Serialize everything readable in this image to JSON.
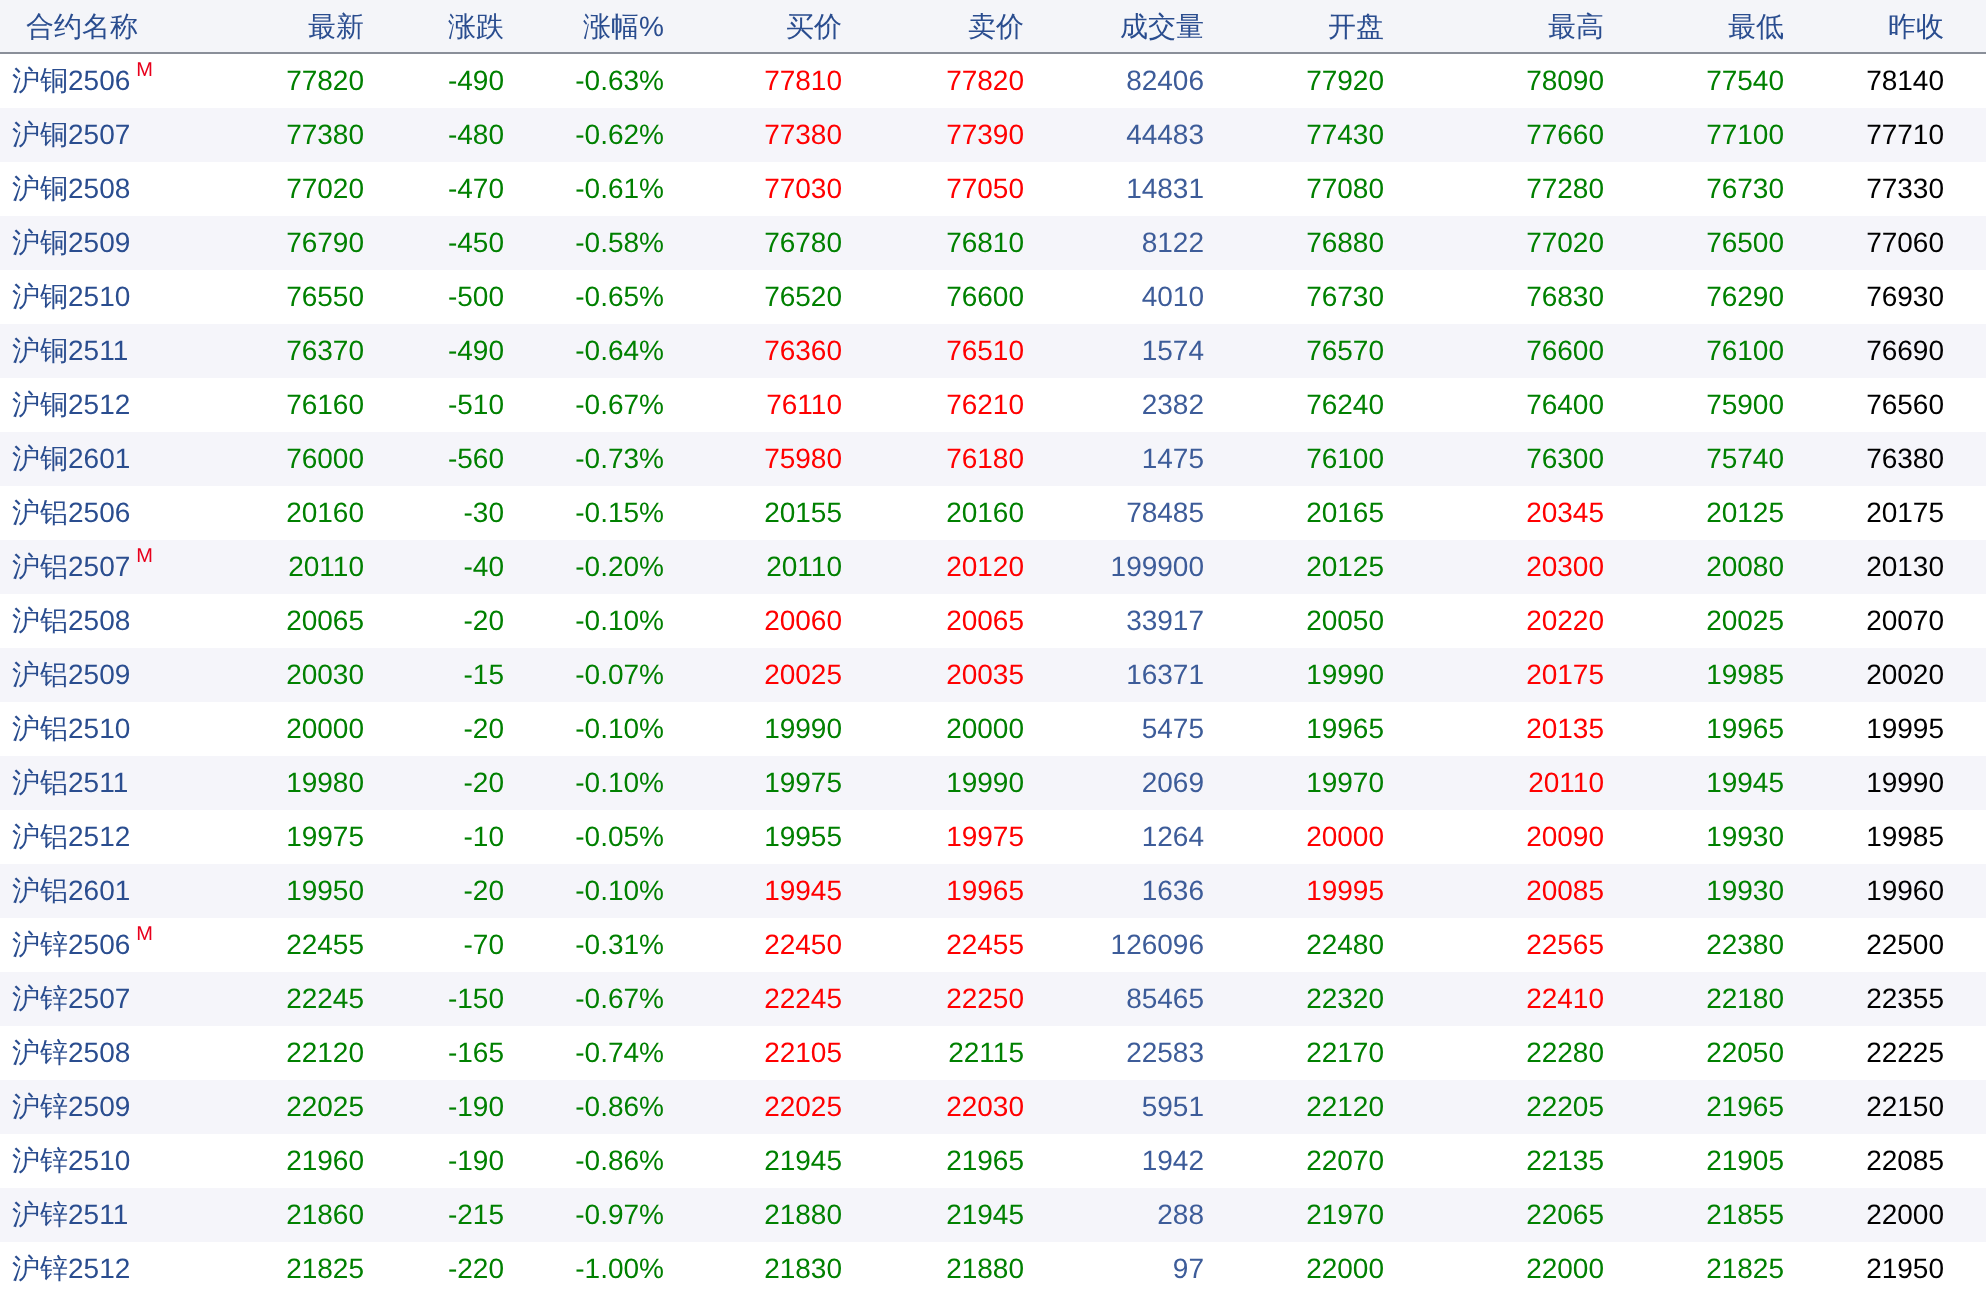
{
  "columns": [
    {
      "label": "合约名称",
      "kind": "name"
    },
    {
      "label": "最新",
      "kind": "value"
    },
    {
      "label": "涨跌",
      "kind": "value"
    },
    {
      "label": "涨幅%",
      "kind": "value"
    },
    {
      "label": "买价",
      "kind": "value"
    },
    {
      "label": "卖价",
      "kind": "value"
    },
    {
      "label": "成交量",
      "kind": "value"
    },
    {
      "label": "开盘",
      "kind": "value"
    },
    {
      "label": "最高",
      "kind": "value"
    },
    {
      "label": "最低",
      "kind": "value"
    },
    {
      "label": "昨收",
      "kind": "value"
    }
  ],
  "rows": [
    {
      "name": "沪铜2506",
      "badge": "M",
      "cells": [
        {
          "text": "77820",
          "color": "#008000"
        },
        {
          "text": "-490",
          "color": "#008000"
        },
        {
          "text": "-0.63%",
          "color": "#008000"
        },
        {
          "text": "77810",
          "color": "#ff0000"
        },
        {
          "text": "77820",
          "color": "#ff0000"
        },
        {
          "text": "82406",
          "color": "#3d5c99"
        },
        {
          "text": "77920",
          "color": "#008000"
        },
        {
          "text": "78090",
          "color": "#008000"
        },
        {
          "text": "77540",
          "color": "#008000"
        },
        {
          "text": "78140",
          "color": "#000000"
        }
      ]
    },
    {
      "name": "沪铜2507",
      "cells": [
        {
          "text": "77380",
          "color": "#008000"
        },
        {
          "text": "-480",
          "color": "#008000"
        },
        {
          "text": "-0.62%",
          "color": "#008000"
        },
        {
          "text": "77380",
          "color": "#ff0000"
        },
        {
          "text": "77390",
          "color": "#ff0000"
        },
        {
          "text": "44483",
          "color": "#3d5c99"
        },
        {
          "text": "77430",
          "color": "#008000"
        },
        {
          "text": "77660",
          "color": "#008000"
        },
        {
          "text": "77100",
          "color": "#008000"
        },
        {
          "text": "77710",
          "color": "#000000"
        }
      ]
    },
    {
      "name": "沪铜2508",
      "cells": [
        {
          "text": "77020",
          "color": "#008000"
        },
        {
          "text": "-470",
          "color": "#008000"
        },
        {
          "text": "-0.61%",
          "color": "#008000"
        },
        {
          "text": "77030",
          "color": "#ff0000"
        },
        {
          "text": "77050",
          "color": "#ff0000"
        },
        {
          "text": "14831",
          "color": "#3d5c99"
        },
        {
          "text": "77080",
          "color": "#008000"
        },
        {
          "text": "77280",
          "color": "#008000"
        },
        {
          "text": "76730",
          "color": "#008000"
        },
        {
          "text": "77330",
          "color": "#000000"
        }
      ]
    },
    {
      "name": "沪铜2509",
      "cells": [
        {
          "text": "76790",
          "color": "#008000"
        },
        {
          "text": "-450",
          "color": "#008000"
        },
        {
          "text": "-0.58%",
          "color": "#008000"
        },
        {
          "text": "76780",
          "color": "#008000"
        },
        {
          "text": "76810",
          "color": "#008000"
        },
        {
          "text": "8122",
          "color": "#3d5c99"
        },
        {
          "text": "76880",
          "color": "#008000"
        },
        {
          "text": "77020",
          "color": "#008000"
        },
        {
          "text": "76500",
          "color": "#008000"
        },
        {
          "text": "77060",
          "color": "#000000"
        }
      ]
    },
    {
      "name": "沪铜2510",
      "cells": [
        {
          "text": "76550",
          "color": "#008000"
        },
        {
          "text": "-500",
          "color": "#008000"
        },
        {
          "text": "-0.65%",
          "color": "#008000"
        },
        {
          "text": "76520",
          "color": "#008000"
        },
        {
          "text": "76600",
          "color": "#008000"
        },
        {
          "text": "4010",
          "color": "#3d5c99"
        },
        {
          "text": "76730",
          "color": "#008000"
        },
        {
          "text": "76830",
          "color": "#008000"
        },
        {
          "text": "76290",
          "color": "#008000"
        },
        {
          "text": "76930",
          "color": "#000000"
        }
      ]
    },
    {
      "name": "沪铜2511",
      "cells": [
        {
          "text": "76370",
          "color": "#008000"
        },
        {
          "text": "-490",
          "color": "#008000"
        },
        {
          "text": "-0.64%",
          "color": "#008000"
        },
        {
          "text": "76360",
          "color": "#ff0000"
        },
        {
          "text": "76510",
          "color": "#ff0000"
        },
        {
          "text": "1574",
          "color": "#3d5c99"
        },
        {
          "text": "76570",
          "color": "#008000"
        },
        {
          "text": "76600",
          "color": "#008000"
        },
        {
          "text": "76100",
          "color": "#008000"
        },
        {
          "text": "76690",
          "color": "#000000"
        }
      ]
    },
    {
      "name": "沪铜2512",
      "cells": [
        {
          "text": "76160",
          "color": "#008000"
        },
        {
          "text": "-510",
          "color": "#008000"
        },
        {
          "text": "-0.67%",
          "color": "#008000"
        },
        {
          "text": "76110",
          "color": "#ff0000"
        },
        {
          "text": "76210",
          "color": "#ff0000"
        },
        {
          "text": "2382",
          "color": "#3d5c99"
        },
        {
          "text": "76240",
          "color": "#008000"
        },
        {
          "text": "76400",
          "color": "#008000"
        },
        {
          "text": "75900",
          "color": "#008000"
        },
        {
          "text": "76560",
          "color": "#000000"
        }
      ]
    },
    {
      "name": "沪铜2601",
      "cells": [
        {
          "text": "76000",
          "color": "#008000"
        },
        {
          "text": "-560",
          "color": "#008000"
        },
        {
          "text": "-0.73%",
          "color": "#008000"
        },
        {
          "text": "75980",
          "color": "#ff0000"
        },
        {
          "text": "76180",
          "color": "#ff0000"
        },
        {
          "text": "1475",
          "color": "#3d5c99"
        },
        {
          "text": "76100",
          "color": "#008000"
        },
        {
          "text": "76300",
          "color": "#008000"
        },
        {
          "text": "75740",
          "color": "#008000"
        },
        {
          "text": "76380",
          "color": "#000000"
        }
      ]
    },
    {
      "name": "沪铝2506",
      "cells": [
        {
          "text": "20160",
          "color": "#008000"
        },
        {
          "text": "-30",
          "color": "#008000"
        },
        {
          "text": "-0.15%",
          "color": "#008000"
        },
        {
          "text": "20155",
          "color": "#008000"
        },
        {
          "text": "20160",
          "color": "#008000"
        },
        {
          "text": "78485",
          "color": "#3d5c99"
        },
        {
          "text": "20165",
          "color": "#008000"
        },
        {
          "text": "20345",
          "color": "#ff0000"
        },
        {
          "text": "20125",
          "color": "#008000"
        },
        {
          "text": "20175",
          "color": "#000000"
        }
      ]
    },
    {
      "name": "沪铝2507",
      "badge": "M",
      "cells": [
        {
          "text": "20110",
          "color": "#008000"
        },
        {
          "text": "-40",
          "color": "#008000"
        },
        {
          "text": "-0.20%",
          "color": "#008000"
        },
        {
          "text": "20110",
          "color": "#008000"
        },
        {
          "text": "20120",
          "color": "#ff0000"
        },
        {
          "text": "199900",
          "color": "#3d5c99"
        },
        {
          "text": "20125",
          "color": "#008000"
        },
        {
          "text": "20300",
          "color": "#ff0000"
        },
        {
          "text": "20080",
          "color": "#008000"
        },
        {
          "text": "20130",
          "color": "#000000"
        }
      ]
    },
    {
      "name": "沪铝2508",
      "cells": [
        {
          "text": "20065",
          "color": "#008000"
        },
        {
          "text": "-20",
          "color": "#008000"
        },
        {
          "text": "-0.10%",
          "color": "#008000"
        },
        {
          "text": "20060",
          "color": "#ff0000"
        },
        {
          "text": "20065",
          "color": "#ff0000"
        },
        {
          "text": "33917",
          "color": "#3d5c99"
        },
        {
          "text": "20050",
          "color": "#008000"
        },
        {
          "text": "20220",
          "color": "#ff0000"
        },
        {
          "text": "20025",
          "color": "#008000"
        },
        {
          "text": "20070",
          "color": "#000000"
        }
      ]
    },
    {
      "name": "沪铝2509",
      "cells": [
        {
          "text": "20030",
          "color": "#008000"
        },
        {
          "text": "-15",
          "color": "#008000"
        },
        {
          "text": "-0.07%",
          "color": "#008000"
        },
        {
          "text": "20025",
          "color": "#ff0000"
        },
        {
          "text": "20035",
          "color": "#ff0000"
        },
        {
          "text": "16371",
          "color": "#3d5c99"
        },
        {
          "text": "19990",
          "color": "#008000"
        },
        {
          "text": "20175",
          "color": "#ff0000"
        },
        {
          "text": "19985",
          "color": "#008000"
        },
        {
          "text": "20020",
          "color": "#000000"
        }
      ]
    },
    {
      "name": "沪铝2510",
      "cells": [
        {
          "text": "20000",
          "color": "#008000"
        },
        {
          "text": "-20",
          "color": "#008000"
        },
        {
          "text": "-0.10%",
          "color": "#008000"
        },
        {
          "text": "19990",
          "color": "#008000"
        },
        {
          "text": "20000",
          "color": "#008000"
        },
        {
          "text": "5475",
          "color": "#3d5c99"
        },
        {
          "text": "19965",
          "color": "#008000"
        },
        {
          "text": "20135",
          "color": "#ff0000"
        },
        {
          "text": "19965",
          "color": "#008000"
        },
        {
          "text": "19995",
          "color": "#000000"
        }
      ]
    },
    {
      "name": "沪铝2511",
      "cells": [
        {
          "text": "19980",
          "color": "#008000"
        },
        {
          "text": "-20",
          "color": "#008000"
        },
        {
          "text": "-0.10%",
          "color": "#008000"
        },
        {
          "text": "19975",
          "color": "#008000"
        },
        {
          "text": "19990",
          "color": "#008000"
        },
        {
          "text": "2069",
          "color": "#3d5c99"
        },
        {
          "text": "19970",
          "color": "#008000"
        },
        {
          "text": "20110",
          "color": "#ff0000"
        },
        {
          "text": "19945",
          "color": "#008000"
        },
        {
          "text": "19990",
          "color": "#000000"
        }
      ]
    },
    {
      "name": "沪铝2512",
      "cells": [
        {
          "text": "19975",
          "color": "#008000"
        },
        {
          "text": "-10",
          "color": "#008000"
        },
        {
          "text": "-0.05%",
          "color": "#008000"
        },
        {
          "text": "19955",
          "color": "#008000"
        },
        {
          "text": "19975",
          "color": "#ff0000"
        },
        {
          "text": "1264",
          "color": "#3d5c99"
        },
        {
          "text": "20000",
          "color": "#ff0000"
        },
        {
          "text": "20090",
          "color": "#ff0000"
        },
        {
          "text": "19930",
          "color": "#008000"
        },
        {
          "text": "19985",
          "color": "#000000"
        }
      ]
    },
    {
      "name": "沪铝2601",
      "cells": [
        {
          "text": "19950",
          "color": "#008000"
        },
        {
          "text": "-20",
          "color": "#008000"
        },
        {
          "text": "-0.10%",
          "color": "#008000"
        },
        {
          "text": "19945",
          "color": "#ff0000"
        },
        {
          "text": "19965",
          "color": "#ff0000"
        },
        {
          "text": "1636",
          "color": "#3d5c99"
        },
        {
          "text": "19995",
          "color": "#ff0000"
        },
        {
          "text": "20085",
          "color": "#ff0000"
        },
        {
          "text": "19930",
          "color": "#008000"
        },
        {
          "text": "19960",
          "color": "#000000"
        }
      ]
    },
    {
      "name": "沪锌2506",
      "badge": "M",
      "cells": [
        {
          "text": "22455",
          "color": "#008000"
        },
        {
          "text": "-70",
          "color": "#008000"
        },
        {
          "text": "-0.31%",
          "color": "#008000"
        },
        {
          "text": "22450",
          "color": "#ff0000"
        },
        {
          "text": "22455",
          "color": "#ff0000"
        },
        {
          "text": "126096",
          "color": "#3d5c99"
        },
        {
          "text": "22480",
          "color": "#008000"
        },
        {
          "text": "22565",
          "color": "#ff0000"
        },
        {
          "text": "22380",
          "color": "#008000"
        },
        {
          "text": "22500",
          "color": "#000000"
        }
      ]
    },
    {
      "name": "沪锌2507",
      "cells": [
        {
          "text": "22245",
          "color": "#008000"
        },
        {
          "text": "-150",
          "color": "#008000"
        },
        {
          "text": "-0.67%",
          "color": "#008000"
        },
        {
          "text": "22245",
          "color": "#ff0000"
        },
        {
          "text": "22250",
          "color": "#ff0000"
        },
        {
          "text": "85465",
          "color": "#3d5c99"
        },
        {
          "text": "22320",
          "color": "#008000"
        },
        {
          "text": "22410",
          "color": "#ff0000"
        },
        {
          "text": "22180",
          "color": "#008000"
        },
        {
          "text": "22355",
          "color": "#000000"
        }
      ]
    },
    {
      "name": "沪锌2508",
      "cells": [
        {
          "text": "22120",
          "color": "#008000"
        },
        {
          "text": "-165",
          "color": "#008000"
        },
        {
          "text": "-0.74%",
          "color": "#008000"
        },
        {
          "text": "22105",
          "color": "#ff0000"
        },
        {
          "text": "22115",
          "color": "#008000"
        },
        {
          "text": "22583",
          "color": "#3d5c99"
        },
        {
          "text": "22170",
          "color": "#008000"
        },
        {
          "text": "22280",
          "color": "#008000"
        },
        {
          "text": "22050",
          "color": "#008000"
        },
        {
          "text": "22225",
          "color": "#000000"
        }
      ]
    },
    {
      "name": "沪锌2509",
      "cells": [
        {
          "text": "22025",
          "color": "#008000"
        },
        {
          "text": "-190",
          "color": "#008000"
        },
        {
          "text": "-0.86%",
          "color": "#008000"
        },
        {
          "text": "22025",
          "color": "#ff0000"
        },
        {
          "text": "22030",
          "color": "#ff0000"
        },
        {
          "text": "5951",
          "color": "#3d5c99"
        },
        {
          "text": "22120",
          "color": "#008000"
        },
        {
          "text": "22205",
          "color": "#008000"
        },
        {
          "text": "21965",
          "color": "#008000"
        },
        {
          "text": "22150",
          "color": "#000000"
        }
      ]
    },
    {
      "name": "沪锌2510",
      "cells": [
        {
          "text": "21960",
          "color": "#008000"
        },
        {
          "text": "-190",
          "color": "#008000"
        },
        {
          "text": "-0.86%",
          "color": "#008000"
        },
        {
          "text": "21945",
          "color": "#008000"
        },
        {
          "text": "21965",
          "color": "#008000"
        },
        {
          "text": "1942",
          "color": "#3d5c99"
        },
        {
          "text": "22070",
          "color": "#008000"
        },
        {
          "text": "22135",
          "color": "#008000"
        },
        {
          "text": "21905",
          "color": "#008000"
        },
        {
          "text": "22085",
          "color": "#000000"
        }
      ]
    },
    {
      "name": "沪锌2511",
      "cells": [
        {
          "text": "21860",
          "color": "#008000"
        },
        {
          "text": "-215",
          "color": "#008000"
        },
        {
          "text": "-0.97%",
          "color": "#008000"
        },
        {
          "text": "21880",
          "color": "#008000"
        },
        {
          "text": "21945",
          "color": "#008000"
        },
        {
          "text": "288",
          "color": "#3d5c99"
        },
        {
          "text": "21970",
          "color": "#008000"
        },
        {
          "text": "22065",
          "color": "#008000"
        },
        {
          "text": "21855",
          "color": "#008000"
        },
        {
          "text": "22000",
          "color": "#000000"
        }
      ]
    },
    {
      "name": "沪锌2512",
      "cells": [
        {
          "text": "21825",
          "color": "#008000"
        },
        {
          "text": "-220",
          "color": "#008000"
        },
        {
          "text": "-1.00%",
          "color": "#008000"
        },
        {
          "text": "21830",
          "color": "#008000"
        },
        {
          "text": "21880",
          "color": "#008000"
        },
        {
          "text": "97",
          "color": "#3d5c99"
        },
        {
          "text": "22000",
          "color": "#008000"
        },
        {
          "text": "22000",
          "color": "#008000"
        },
        {
          "text": "21825",
          "color": "#008000"
        },
        {
          "text": "21950",
          "color": "#000000"
        }
      ]
    }
  ]
}
